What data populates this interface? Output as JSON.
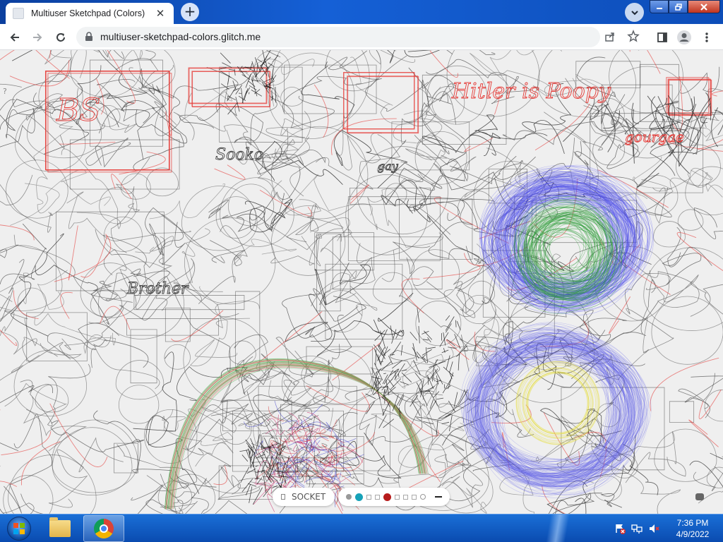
{
  "browser": {
    "tab_title": "Multiuser Sketchpad (Colors)",
    "url": "multiuser-sketchpad-colors.glitch.me",
    "accent_color": "#0a4fbd"
  },
  "page": {
    "help_mark": "?",
    "socket_label": "SOCKET",
    "colors": [
      "#999999",
      "#17a2b8",
      "#ffffff",
      "#ffffff",
      "#b71c1c",
      "#ffffff",
      "#ffffff",
      "#ffffff",
      "#ffffff"
    ],
    "selected_color": "#17a2b8",
    "scribble_text": [
      "Sooko",
      "Hitler is Poopy",
      "gourgae",
      "Brother",
      "gay",
      "BS"
    ]
  },
  "taskbar": {
    "time": "7:36 PM",
    "date": "4/9/2022",
    "apps": [
      "windows-explorer",
      "google-chrome"
    ]
  }
}
